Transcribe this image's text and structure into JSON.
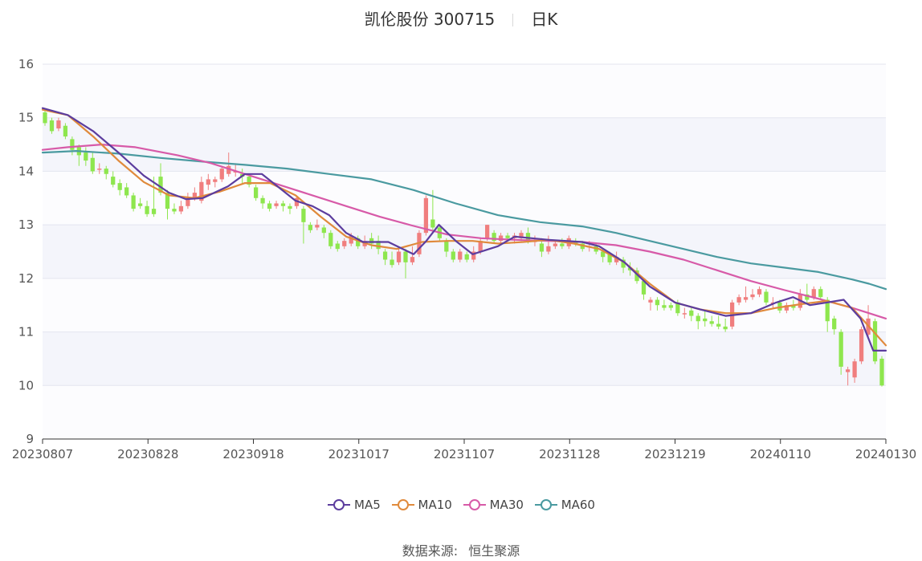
{
  "header": {
    "title": "凯伦股份 300715",
    "period": "日K"
  },
  "legend": [
    {
      "label": "MA5",
      "color": "#5c3d9e"
    },
    {
      "label": "MA10",
      "color": "#e08a3c"
    },
    {
      "label": "MA30",
      "color": "#d75aa8"
    },
    {
      "label": "MA60",
      "color": "#4a9aa0"
    }
  ],
  "source": {
    "label": "数据来源:",
    "value": "恒生聚源"
  },
  "colors": {
    "up": "#f07e7e",
    "down": "#8ee64e",
    "band": "#f4f5fb",
    "grid": "#e3e5ef",
    "axis": "#333333"
  },
  "chart_data": {
    "type": "candlestick",
    "title": "凯伦股份 300715 日K",
    "ylim": [
      9,
      16
    ],
    "yticks": [
      "9",
      "10",
      "11",
      "12",
      "13",
      "14",
      "15",
      "16"
    ],
    "xticks": [
      "20230807",
      "20230828",
      "20230918",
      "20231017",
      "20231107",
      "20231128",
      "20231219",
      "20240110",
      "20240130"
    ],
    "grid": true,
    "legend_position": "bottom",
    "candles": [
      [
        15.1,
        14.9,
        15.15,
        14.85
      ],
      [
        14.95,
        14.75,
        15.0,
        14.7
      ],
      [
        14.8,
        14.95,
        15.0,
        14.75
      ],
      [
        14.85,
        14.65,
        14.9,
        14.6
      ],
      [
        14.6,
        14.4,
        14.65,
        14.3
      ],
      [
        14.45,
        14.3,
        14.5,
        14.1
      ],
      [
        14.35,
        14.2,
        14.45,
        14.1
      ],
      [
        14.25,
        14.0,
        14.35,
        13.95
      ],
      [
        14.05,
        14.05,
        14.15,
        13.95
      ],
      [
        14.05,
        13.95,
        14.1,
        13.85
      ],
      [
        13.9,
        13.75,
        14.0,
        13.7
      ],
      [
        13.78,
        13.65,
        13.85,
        13.55
      ],
      [
        13.7,
        13.55,
        13.78,
        13.5
      ],
      [
        13.55,
        13.3,
        13.6,
        13.25
      ],
      [
        13.4,
        13.35,
        13.5,
        13.3
      ],
      [
        13.35,
        13.2,
        13.45,
        13.15
      ],
      [
        13.3,
        13.2,
        13.9,
        13.15
      ],
      [
        13.9,
        13.6,
        14.15,
        13.55
      ],
      [
        13.6,
        13.3,
        13.65,
        13.1
      ],
      [
        13.3,
        13.25,
        13.4,
        13.2
      ],
      [
        13.25,
        13.35,
        13.45,
        13.2
      ],
      [
        13.35,
        13.5,
        13.6,
        13.3
      ],
      [
        13.5,
        13.6,
        13.7,
        13.45
      ],
      [
        13.45,
        13.8,
        13.9,
        13.4
      ],
      [
        13.75,
        13.85,
        13.95,
        13.65
      ],
      [
        13.8,
        13.85,
        13.9,
        13.7
      ],
      [
        13.85,
        14.05,
        14.1,
        13.8
      ],
      [
        13.95,
        14.1,
        14.35,
        13.9
      ],
      [
        14.0,
        14.0,
        14.15,
        13.9
      ],
      [
        13.95,
        13.9,
        14.05,
        13.75
      ],
      [
        13.9,
        13.75,
        13.95,
        13.7
      ],
      [
        13.7,
        13.5,
        13.75,
        13.45
      ],
      [
        13.5,
        13.4,
        13.55,
        13.3
      ],
      [
        13.4,
        13.3,
        13.45,
        13.25
      ],
      [
        13.35,
        13.4,
        13.45,
        13.3
      ],
      [
        13.4,
        13.35,
        13.45,
        13.25
      ],
      [
        13.35,
        13.3,
        13.4,
        13.2
      ],
      [
        13.35,
        13.5,
        13.55,
        13.3
      ],
      [
        13.3,
        13.05,
        13.35,
        12.65
      ],
      [
        13.0,
        12.9,
        13.05,
        12.85
      ],
      [
        12.95,
        13.0,
        13.1,
        12.9
      ],
      [
        12.95,
        12.85,
        13.0,
        12.75
      ],
      [
        12.85,
        12.6,
        12.9,
        12.55
      ],
      [
        12.65,
        12.55,
        12.7,
        12.5
      ],
      [
        12.6,
        12.7,
        12.75,
        12.55
      ],
      [
        12.65,
        12.8,
        12.85,
        12.6
      ],
      [
        12.75,
        12.6,
        12.8,
        12.55
      ],
      [
        12.6,
        12.7,
        12.8,
        12.55
      ],
      [
        12.75,
        12.65,
        12.85,
        12.55
      ],
      [
        12.7,
        12.55,
        12.8,
        12.45
      ],
      [
        12.5,
        12.35,
        12.55,
        12.25
      ],
      [
        12.35,
        12.25,
        12.5,
        12.2
      ],
      [
        12.3,
        12.5,
        12.55,
        12.25
      ],
      [
        12.5,
        12.3,
        12.55,
        12.0
      ],
      [
        12.3,
        12.4,
        12.6,
        12.25
      ],
      [
        12.45,
        12.85,
        12.9,
        12.4
      ],
      [
        12.85,
        13.5,
        13.55,
        12.8
      ],
      [
        13.1,
        12.95,
        13.65,
        12.9
      ],
      [
        12.95,
        12.75,
        13.0,
        12.7
      ],
      [
        12.7,
        12.5,
        12.75,
        12.4
      ],
      [
        12.5,
        12.35,
        12.55,
        12.3
      ],
      [
        12.35,
        12.5,
        12.55,
        12.3
      ],
      [
        12.45,
        12.35,
        12.5,
        12.3
      ],
      [
        12.35,
        12.5,
        12.6,
        12.3
      ],
      [
        12.5,
        12.7,
        12.75,
        12.45
      ],
      [
        12.75,
        13.0,
        13.0,
        12.7
      ],
      [
        12.85,
        12.7,
        12.9,
        12.65
      ],
      [
        12.7,
        12.8,
        12.85,
        12.65
      ],
      [
        12.8,
        12.75,
        12.85,
        12.7
      ],
      [
        12.75,
        12.8,
        12.85,
        12.65
      ],
      [
        12.75,
        12.85,
        12.9,
        12.7
      ],
      [
        12.85,
        12.7,
        12.95,
        12.65
      ],
      [
        12.7,
        12.7,
        12.8,
        12.6
      ],
      [
        12.65,
        12.5,
        12.75,
        12.4
      ],
      [
        12.5,
        12.6,
        12.8,
        12.45
      ],
      [
        12.6,
        12.65,
        12.7,
        12.55
      ],
      [
        12.65,
        12.6,
        12.75,
        12.55
      ],
      [
        12.6,
        12.75,
        12.8,
        12.55
      ],
      [
        12.7,
        12.65,
        12.75,
        12.6
      ],
      [
        12.65,
        12.55,
        12.7,
        12.5
      ],
      [
        12.6,
        12.6,
        12.7,
        12.5
      ],
      [
        12.6,
        12.5,
        12.65,
        12.45
      ],
      [
        12.5,
        12.4,
        12.55,
        12.3
      ],
      [
        12.45,
        12.3,
        12.5,
        12.25
      ],
      [
        12.3,
        12.4,
        12.5,
        12.25
      ],
      [
        12.35,
        12.2,
        12.4,
        12.1
      ],
      [
        12.2,
        12.15,
        12.3,
        12.05
      ],
      [
        12.15,
        11.95,
        12.2,
        11.9
      ],
      [
        11.95,
        11.7,
        12.0,
        11.6
      ],
      [
        11.55,
        11.6,
        11.65,
        11.4
      ],
      [
        11.6,
        11.5,
        11.65,
        11.4
      ],
      [
        11.5,
        11.45,
        11.6,
        11.4
      ],
      [
        11.5,
        11.45,
        11.55,
        11.4
      ],
      [
        11.55,
        11.35,
        11.6,
        11.3
      ],
      [
        11.35,
        11.35,
        11.45,
        11.25
      ],
      [
        11.4,
        11.3,
        11.45,
        11.2
      ],
      [
        11.3,
        11.2,
        11.35,
        11.05
      ],
      [
        11.25,
        11.2,
        11.4,
        11.1
      ],
      [
        11.2,
        11.15,
        11.3,
        11.1
      ],
      [
        11.15,
        11.1,
        11.3,
        11.05
      ],
      [
        11.1,
        11.05,
        11.25,
        11.0
      ],
      [
        11.1,
        11.55,
        11.6,
        11.05
      ],
      [
        11.55,
        11.65,
        11.7,
        11.5
      ],
      [
        11.6,
        11.65,
        11.85,
        11.55
      ],
      [
        11.65,
        11.7,
        11.8,
        11.6
      ],
      [
        11.7,
        11.8,
        11.85,
        11.65
      ],
      [
        11.75,
        11.55,
        11.8,
        11.5
      ],
      [
        11.55,
        11.55,
        11.65,
        11.45
      ],
      [
        11.55,
        11.4,
        11.6,
        11.35
      ],
      [
        11.4,
        11.5,
        11.55,
        11.35
      ],
      [
        11.5,
        11.45,
        11.6,
        11.4
      ],
      [
        11.45,
        11.7,
        11.8,
        11.4
      ],
      [
        11.7,
        11.6,
        11.9,
        11.55
      ],
      [
        11.65,
        11.8,
        11.85,
        11.6
      ],
      [
        11.8,
        11.65,
        11.85,
        11.6
      ],
      [
        11.6,
        11.2,
        11.65,
        11.0
      ],
      [
        11.25,
        11.05,
        11.3,
        10.95
      ],
      [
        11.0,
        10.35,
        11.05,
        10.2
      ],
      [
        10.25,
        10.3,
        10.35,
        10.0
      ],
      [
        10.15,
        10.45,
        10.5,
        10.05
      ],
      [
        10.45,
        11.05,
        11.1,
        10.4
      ],
      [
        10.95,
        11.25,
        11.5,
        10.9
      ],
      [
        11.2,
        10.45,
        11.25,
        10.4
      ],
      [
        10.5,
        10.0,
        10.55,
        9.98
      ]
    ],
    "ma5": [
      [
        0,
        15.18
      ],
      [
        0.03,
        15.05
      ],
      [
        0.06,
        14.75
      ],
      [
        0.09,
        14.35
      ],
      [
        0.12,
        13.92
      ],
      [
        0.15,
        13.6
      ],
      [
        0.17,
        13.48
      ],
      [
        0.19,
        13.5
      ],
      [
        0.22,
        13.72
      ],
      [
        0.24,
        13.95
      ],
      [
        0.26,
        13.95
      ],
      [
        0.28,
        13.7
      ],
      [
        0.3,
        13.45
      ],
      [
        0.32,
        13.35
      ],
      [
        0.34,
        13.18
      ],
      [
        0.36,
        12.85
      ],
      [
        0.38,
        12.68
      ],
      [
        0.41,
        12.68
      ],
      [
        0.44,
        12.45
      ],
      [
        0.455,
        12.7
      ],
      [
        0.47,
        13.0
      ],
      [
        0.49,
        12.7
      ],
      [
        0.51,
        12.45
      ],
      [
        0.54,
        12.6
      ],
      [
        0.56,
        12.78
      ],
      [
        0.6,
        12.72
      ],
      [
        0.64,
        12.68
      ],
      [
        0.66,
        12.6
      ],
      [
        0.69,
        12.3
      ],
      [
        0.72,
        11.85
      ],
      [
        0.75,
        11.55
      ],
      [
        0.78,
        11.42
      ],
      [
        0.81,
        11.3
      ],
      [
        0.84,
        11.35
      ],
      [
        0.87,
        11.55
      ],
      [
        0.89,
        11.65
      ],
      [
        0.91,
        11.5
      ],
      [
        0.93,
        11.55
      ],
      [
        0.95,
        11.6
      ],
      [
        0.97,
        11.25
      ],
      [
        0.985,
        10.65
      ],
      [
        1.0,
        10.65
      ]
    ],
    "ma10": [
      [
        0,
        15.15
      ],
      [
        0.03,
        15.05
      ],
      [
        0.06,
        14.65
      ],
      [
        0.09,
        14.2
      ],
      [
        0.12,
        13.8
      ],
      [
        0.15,
        13.55
      ],
      [
        0.18,
        13.5
      ],
      [
        0.21,
        13.62
      ],
      [
        0.24,
        13.78
      ],
      [
        0.27,
        13.78
      ],
      [
        0.3,
        13.55
      ],
      [
        0.33,
        13.15
      ],
      [
        0.36,
        12.78
      ],
      [
        0.39,
        12.62
      ],
      [
        0.42,
        12.55
      ],
      [
        0.45,
        12.68
      ],
      [
        0.48,
        12.7
      ],
      [
        0.51,
        12.7
      ],
      [
        0.54,
        12.65
      ],
      [
        0.57,
        12.68
      ],
      [
        0.6,
        12.72
      ],
      [
        0.63,
        12.65
      ],
      [
        0.66,
        12.55
      ],
      [
        0.69,
        12.3
      ],
      [
        0.72,
        11.9
      ],
      [
        0.75,
        11.55
      ],
      [
        0.78,
        11.42
      ],
      [
        0.81,
        11.35
      ],
      [
        0.84,
        11.35
      ],
      [
        0.87,
        11.45
      ],
      [
        0.9,
        11.52
      ],
      [
        0.93,
        11.58
      ],
      [
        0.96,
        11.45
      ],
      [
        0.98,
        11.1
      ],
      [
        1.0,
        10.75
      ]
    ],
    "ma30": [
      [
        0,
        14.4
      ],
      [
        0.03,
        14.45
      ],
      [
        0.07,
        14.5
      ],
      [
        0.11,
        14.45
      ],
      [
        0.16,
        14.3
      ],
      [
        0.2,
        14.15
      ],
      [
        0.24,
        13.95
      ],
      [
        0.28,
        13.75
      ],
      [
        0.32,
        13.55
      ],
      [
        0.36,
        13.35
      ],
      [
        0.4,
        13.15
      ],
      [
        0.44,
        12.98
      ],
      [
        0.48,
        12.82
      ],
      [
        0.52,
        12.75
      ],
      [
        0.56,
        12.72
      ],
      [
        0.6,
        12.7
      ],
      [
        0.64,
        12.68
      ],
      [
        0.68,
        12.62
      ],
      [
        0.72,
        12.5
      ],
      [
        0.76,
        12.35
      ],
      [
        0.8,
        12.15
      ],
      [
        0.84,
        11.95
      ],
      [
        0.88,
        11.78
      ],
      [
        0.92,
        11.62
      ],
      [
        0.96,
        11.45
      ],
      [
        0.98,
        11.35
      ],
      [
        1.0,
        11.25
      ]
    ],
    "ma60": [
      [
        0,
        14.35
      ],
      [
        0.04,
        14.38
      ],
      [
        0.09,
        14.33
      ],
      [
        0.14,
        14.25
      ],
      [
        0.19,
        14.18
      ],
      [
        0.24,
        14.12
      ],
      [
        0.29,
        14.05
      ],
      [
        0.34,
        13.95
      ],
      [
        0.39,
        13.85
      ],
      [
        0.44,
        13.65
      ],
      [
        0.49,
        13.4
      ],
      [
        0.54,
        13.18
      ],
      [
        0.59,
        13.05
      ],
      [
        0.64,
        12.97
      ],
      [
        0.68,
        12.85
      ],
      [
        0.72,
        12.7
      ],
      [
        0.76,
        12.55
      ],
      [
        0.8,
        12.4
      ],
      [
        0.84,
        12.28
      ],
      [
        0.88,
        12.2
      ],
      [
        0.92,
        12.12
      ],
      [
        0.96,
        11.98
      ],
      [
        0.98,
        11.9
      ],
      [
        1.0,
        11.8
      ]
    ]
  }
}
